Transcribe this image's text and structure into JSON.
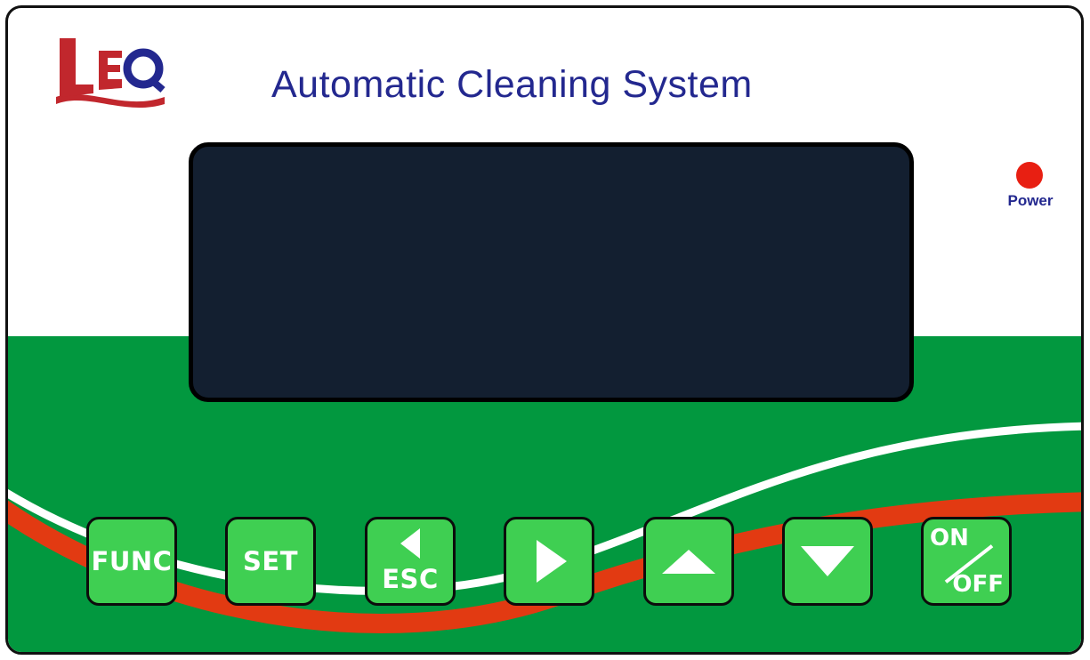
{
  "brand": {
    "logo_text": "LEO",
    "logo_icon": "leo-logo-icon"
  },
  "header": {
    "title": "Automatic Cleaning System"
  },
  "indicator": {
    "power_label": "Power"
  },
  "keys": {
    "func_label": "FUNC",
    "set_label": "SET",
    "esc_label": "ESC",
    "on_label": "ON",
    "off_label": "OFF"
  },
  "colors": {
    "title": "#23288f",
    "panel_green": "#02983f",
    "key_green": "#3fcf52",
    "display": "#131f30",
    "led": "#e81f12",
    "wave_red": "#e23a12"
  }
}
